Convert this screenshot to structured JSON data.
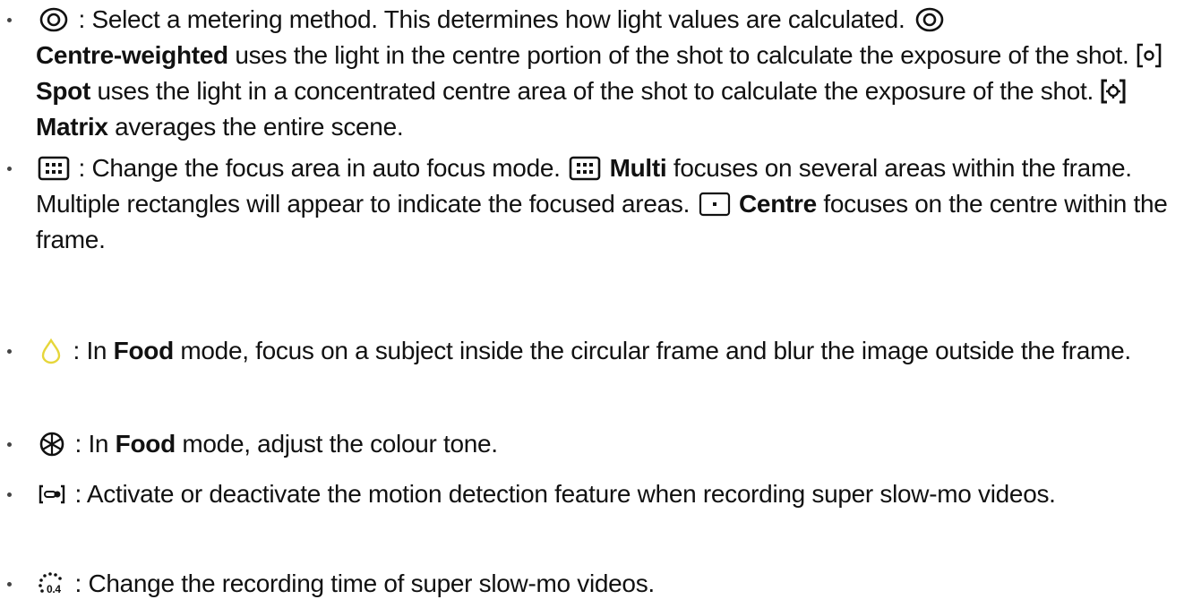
{
  "items": [
    {
      "icon": "metering-icon",
      "parts": [
        " : Select a metering method. This determines how light values are calculated. ",
        "Centre-weighted",
        " uses the light in the centre portion of the shot to calculate the exposure of the shot. ",
        "Spot",
        " uses the light in a concentrated centre area of the shot to calculate the exposure of the shot. ",
        "Matrix",
        " averages the entire scene."
      ]
    },
    {
      "icon": "focus-area-icon",
      "parts": [
        " : Change the focus area in auto focus mode. ",
        "Multi",
        " focuses on several areas within the frame. Multiple rectangles will appear to indicate the focused areas. ",
        "Centre",
        " focuses on the centre within the frame."
      ]
    },
    {
      "icon": "drop-icon",
      "parts": [
        " : In ",
        "Food",
        " mode, focus on a subject inside the circular frame and blur the image outside the frame."
      ]
    },
    {
      "icon": "colour-tone-icon",
      "parts": [
        " : In ",
        "Food",
        " mode, adjust the colour tone."
      ]
    },
    {
      "icon": "motion-detection-icon",
      "parts": [
        " : Activate or deactivate the motion detection feature when recording super slow-mo videos."
      ]
    },
    {
      "icon": "recording-time-icon",
      "icon_text": "0.4",
      "parts": [
        " : Change the recording time of super slow-mo videos."
      ]
    }
  ],
  "colors": {
    "text": "#111111",
    "drop_icon": "#e6d63a"
  }
}
